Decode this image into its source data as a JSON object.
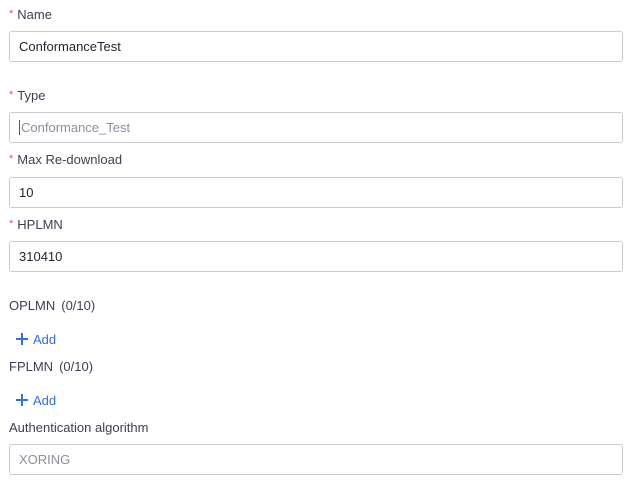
{
  "fields": {
    "name": {
      "required_mark": "*",
      "label": "Name",
      "value": "ConformanceTest"
    },
    "type": {
      "required_mark": "*",
      "label": "Type",
      "value": "Conformance_Test"
    },
    "max_redownload": {
      "required_mark": "*",
      "label": "Max Re-download",
      "value": "10"
    },
    "hplmn": {
      "required_mark": "*",
      "label": "HPLMN",
      "value": "310410"
    },
    "oplmn": {
      "label": "OPLMN",
      "count": "(0/10)",
      "add_label": "Add"
    },
    "fplmn": {
      "label": "FPLMN",
      "count": "(0/10)",
      "add_label": "Add"
    },
    "auth_algorithm": {
      "label": "Authentication algorithm",
      "value": "XORING"
    }
  },
  "colors": {
    "required": "#e0584b",
    "accent": "#2f6fe0",
    "label": "#3a3f55",
    "border": "#c9ccd3"
  }
}
